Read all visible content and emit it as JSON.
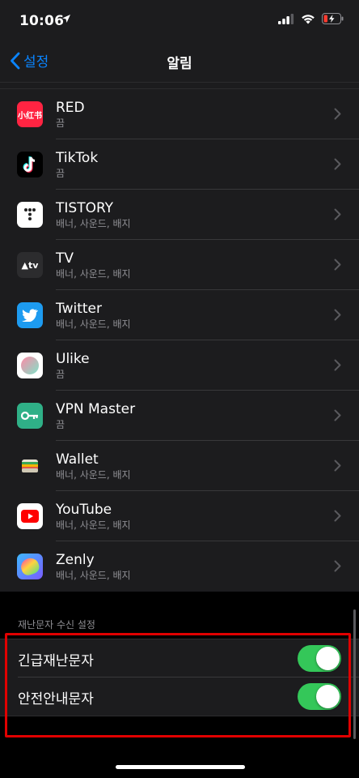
{
  "status": {
    "time": "10:06"
  },
  "nav": {
    "back_label": "설정",
    "title": "알림"
  },
  "apps": [
    {
      "name": "RED",
      "sub": "끔",
      "icon": "red-app-icon",
      "color": "#ff2442"
    },
    {
      "name": "TikTok",
      "sub": "끔",
      "icon": "tiktok-icon",
      "color": "#000000"
    },
    {
      "name": "TISTORY",
      "sub": "배너, 사운드, 배지",
      "icon": "tistory-icon",
      "color": "#ffffff"
    },
    {
      "name": "TV",
      "sub": "배너, 사운드, 배지",
      "icon": "apple-tv-icon",
      "color": "#1c1c1e"
    },
    {
      "name": "Twitter",
      "sub": "배너, 사운드, 배지",
      "icon": "twitter-icon",
      "color": "#1d9bf0"
    },
    {
      "name": "Ulike",
      "sub": "끔",
      "icon": "ulike-icon",
      "color": "#ffffff"
    },
    {
      "name": "VPN Master",
      "sub": "끔",
      "icon": "vpn-master-icon",
      "color": "#2fb087"
    },
    {
      "name": "Wallet",
      "sub": "배너, 사운드, 배지",
      "icon": "wallet-icon",
      "color": "#1c1c1e"
    },
    {
      "name": "YouTube",
      "sub": "배너, 사운드, 배지",
      "icon": "youtube-icon",
      "color": "#ffffff"
    },
    {
      "name": "Zenly",
      "sub": "배너, 사운드, 배지",
      "icon": "zenly-icon",
      "color": "#3db8ff"
    }
  ],
  "emergency": {
    "header": "재난문자 수신 설정",
    "toggles": [
      {
        "label": "긴급재난문자",
        "on": true
      },
      {
        "label": "안전안내문자",
        "on": true
      }
    ]
  },
  "colors": {
    "accent": "#0a84ff",
    "switch_on": "#34c759",
    "highlight": "#e00000"
  }
}
